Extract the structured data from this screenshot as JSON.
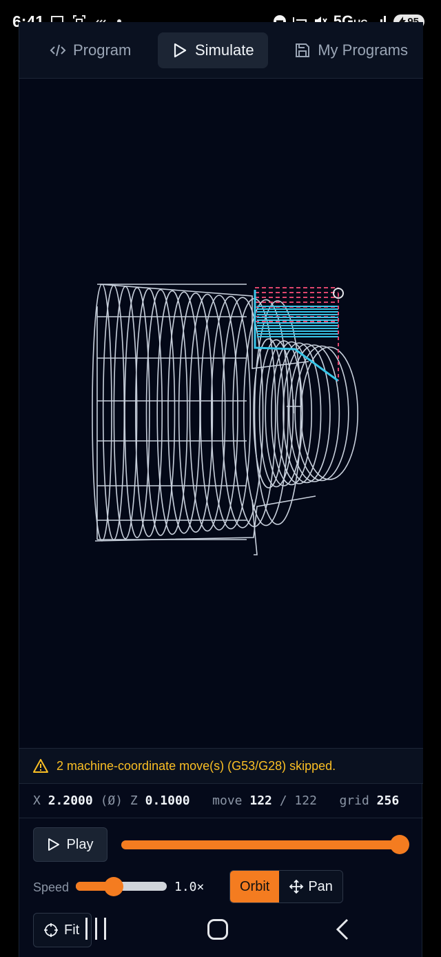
{
  "status_bar": {
    "time": "6:41",
    "network": "5G",
    "network_sub": "UC",
    "battery": "95"
  },
  "tabs": [
    {
      "label": "Program",
      "icon": "code-icon",
      "active": false
    },
    {
      "label": "Simulate",
      "icon": "play-icon",
      "active": true
    },
    {
      "label": "My Programs",
      "icon": "save-icon",
      "active": false
    }
  ],
  "warning": {
    "icon": "warning-triangle-icon",
    "text": "2 machine-coordinate move(s) (G53/G28) skipped."
  },
  "readout": {
    "x_label": "X",
    "x_value": "2.2000",
    "x_suffix": "(Ø)",
    "z_label": "Z",
    "z_value": "0.1000",
    "move_label": "move",
    "move_current": "122",
    "move_separator": "/",
    "move_total": "122",
    "grid_label": "grid",
    "grid_value": "256"
  },
  "playback": {
    "play_label": "Play",
    "progress_fraction": 1.0
  },
  "speed": {
    "label": "Speed",
    "value_text": "1.0×",
    "fraction": 0.42
  },
  "view_modes": {
    "orbit_label": "Orbit",
    "pan_label": "Pan",
    "active": "orbit"
  },
  "fit": {
    "label": "Fit"
  },
  "colors": {
    "accent": "#f47c20",
    "wireframe": "#c8d0dc",
    "toolpath_cut": "#38c6e8",
    "toolpath_rapid": "#e0466e",
    "warning": "#fbbf24"
  }
}
